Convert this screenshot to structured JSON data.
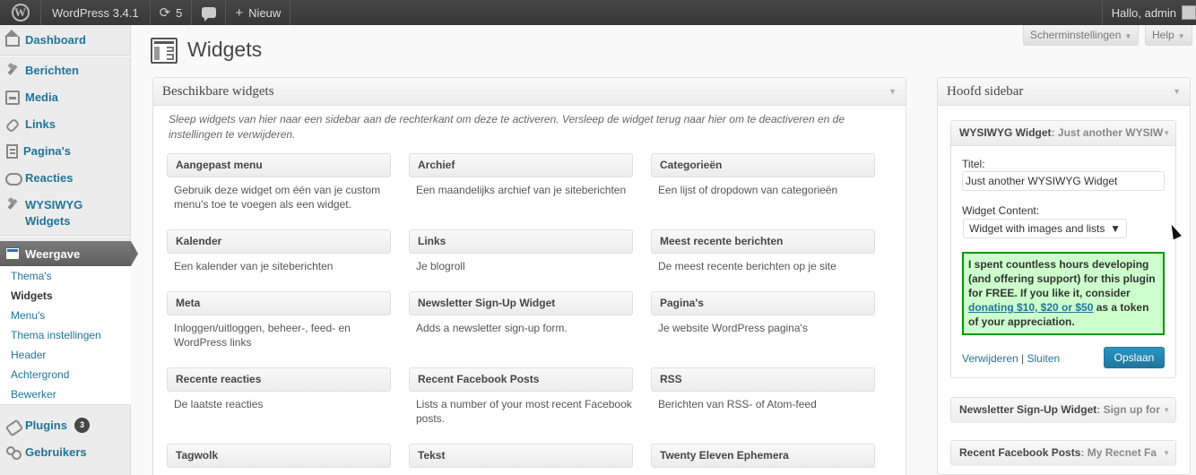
{
  "adminbar": {
    "site_name": "WordPress 3.4.1",
    "updates_count": "5",
    "new_label": "Nieuw",
    "greeting": "Hallo, admin"
  },
  "menu": {
    "dashboard": "Dashboard",
    "posts": "Berichten",
    "media": "Media",
    "links": "Links",
    "pages": "Pagina's",
    "comments": "Reacties",
    "wysiwyg_line1": "WYSIWYG",
    "wysiwyg_line2": "Widgets",
    "appearance": "Weergave",
    "submenu": [
      "Thema's",
      "Widgets",
      "Menu's",
      "Thema instellingen",
      "Header",
      "Achtergrond",
      "Bewerker"
    ],
    "plugins": "Plugins",
    "plugins_count": "3",
    "users": "Gebruikers"
  },
  "screen_options": "Scherminstellingen",
  "help": "Help",
  "page_title": "Widgets",
  "available": {
    "title": "Beschikbare widgets",
    "description": "Sleep widgets van hier naar een sidebar aan de rechterkant om deze te activeren. Versleep de widget terug naar hier om te deactiveren en de instellingen te verwijderen.",
    "widgets": [
      {
        "title": "Aangepast menu",
        "desc": "Gebruik deze widget om één van je custom menu’s toe te voegen als een widget."
      },
      {
        "title": "Archief",
        "desc": "Een maandelijks archief van je siteberichten"
      },
      {
        "title": "Categorieën",
        "desc": "Een lijst of dropdown van categorieën"
      },
      {
        "title": "Kalender",
        "desc": "Een kalender van je siteberichten"
      },
      {
        "title": "Links",
        "desc": "Je blogroll"
      },
      {
        "title": "Meest recente berichten",
        "desc": "De meest recente berichten op je site"
      },
      {
        "title": "Meta",
        "desc": "Inloggen/uitloggen, beheer-, feed- en WordPress links"
      },
      {
        "title": "Newsletter Sign-Up Widget",
        "desc": "Adds a newsletter sign-up form."
      },
      {
        "title": "Pagina's",
        "desc": "Je website WordPress pagina's"
      },
      {
        "title": "Recente reacties",
        "desc": "De laatste reacties"
      },
      {
        "title": "Recent Facebook Posts",
        "desc": "Lists a number of your most recent Facebook posts."
      },
      {
        "title": "RSS",
        "desc": "Berichten van RSS- of Atom-feed"
      },
      {
        "title": "Tagwolk",
        "desc": ""
      },
      {
        "title": "Tekst",
        "desc": ""
      },
      {
        "title": "Twenty Eleven Ephemera",
        "desc": ""
      }
    ]
  },
  "sidebar": {
    "title": "Hoofd sidebar",
    "open_widget": {
      "name": "WYSIWYG Widget",
      "subtitle": ": Just another WYSIW",
      "title_label": "Titel:",
      "title_value": "Just another WYSIWYG Widget",
      "content_label": "Widget Content:",
      "content_value": "Widget with images and lists",
      "notice_pre": "I spent countless hours developing (and offering support) for this plugin for FREE. If you like it, consider ",
      "notice_link": "donating $10, $20 or $50",
      "notice_post": " as a token of your appreciation.",
      "delete_label": "Verwijderen",
      "separator": "|",
      "close_label": "Sluiten",
      "save_label": "Opslaan"
    },
    "collapsed": [
      {
        "name": "Newsletter Sign-Up Widget",
        "subtitle": ": Sign up for"
      },
      {
        "name": "Recent Facebook Posts",
        "subtitle": ": My Recnet Fa"
      }
    ]
  }
}
